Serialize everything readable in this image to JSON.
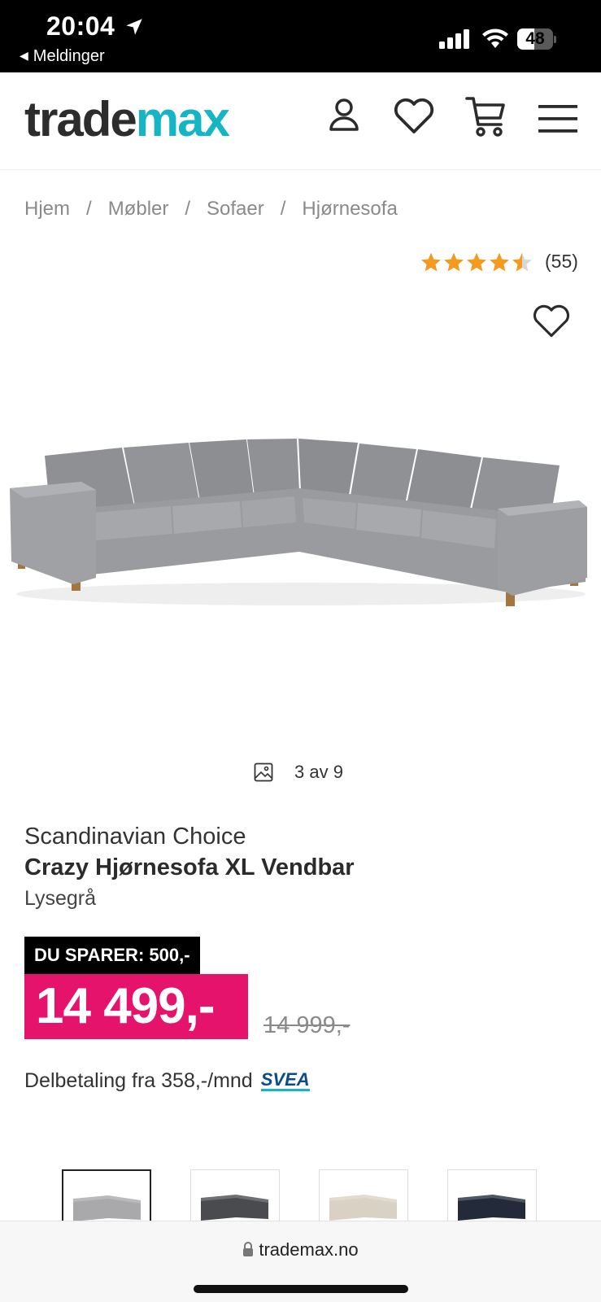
{
  "status_bar": {
    "time": "20:04",
    "back_label": "Meldinger",
    "battery": "48",
    "battery_level": 0.48
  },
  "header": {
    "logo_part1": "trade",
    "logo_part2": "max",
    "icons": [
      "account-icon",
      "heart-icon",
      "cart-icon",
      "menu-icon"
    ]
  },
  "breadcrumb": [
    "Hjem",
    "Møbler",
    "Sofaer",
    "Hjørnesofa"
  ],
  "breadcrumb_separator": "/",
  "rating": {
    "value": 4.5,
    "max": 5,
    "count": "(55)"
  },
  "gallery": {
    "counter": "3 av 9"
  },
  "product": {
    "brand": "Scandinavian Choice",
    "name": "Crazy Hjørnesofa XL Vendbar",
    "variant": "Lysegrå",
    "save_badge": "DU SPARER: 500,-",
    "price": "14 499,-",
    "old_price": "14 999,-",
    "installment": "Delbetaling fra 358,-/mnd",
    "installment_provider": "SVEA"
  },
  "thumbnails": [
    {
      "color": "#a9a9ab",
      "active": true
    },
    {
      "color": "#4a4b4e",
      "active": false
    },
    {
      "color": "#d9d2c4",
      "active": false
    },
    {
      "color": "#232a3a",
      "active": false
    }
  ],
  "browser": {
    "url": "trademax.no"
  },
  "colors": {
    "brand_teal": "#15b5c6",
    "price_pink": "#e5136b",
    "star": "#f39a1f"
  }
}
